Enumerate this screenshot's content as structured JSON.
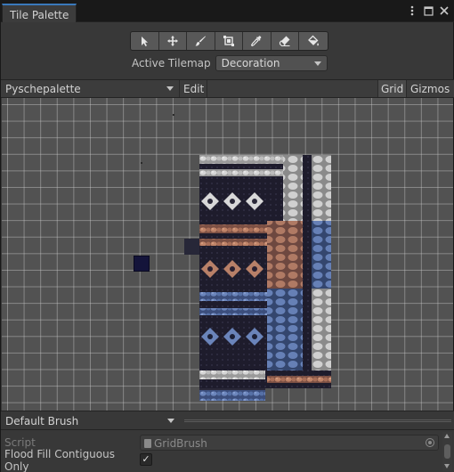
{
  "window": {
    "tab_title": "Tile Palette",
    "icons": [
      "kebab-menu-icon",
      "maximize-icon",
      "close-icon"
    ]
  },
  "toolbar": {
    "tools": [
      {
        "name": "select-tool",
        "icon": "arrow-pointer-icon"
      },
      {
        "name": "move-tool",
        "icon": "move-arrows-icon"
      },
      {
        "name": "paint-tool",
        "icon": "paintbrush-icon"
      },
      {
        "name": "box-fill-tool",
        "icon": "box-fill-icon"
      },
      {
        "name": "picker-tool",
        "icon": "eyedropper-icon"
      },
      {
        "name": "erase-tool",
        "icon": "eraser-icon"
      },
      {
        "name": "fill-tool",
        "icon": "paint-bucket-icon"
      }
    ],
    "active_tilemap_label": "Active Tilemap",
    "active_tilemap_value": "Decoration"
  },
  "palette_bar": {
    "palette_name": "Pyschepalette",
    "edit_label": "Edit",
    "grid_label": "Grid",
    "gizmos_label": "Gizmos"
  },
  "brush_bar": {
    "brush_name": "Default Brush"
  },
  "inspector": {
    "script_label": "Script",
    "script_value": "GridBrush",
    "flood_fill_label": "Flood Fill Contiguous Only",
    "flood_fill_checked": "✓"
  },
  "colors": {
    "accent": "#3a79bb",
    "window_bg": "#383838",
    "grid_bg": "#525252"
  }
}
